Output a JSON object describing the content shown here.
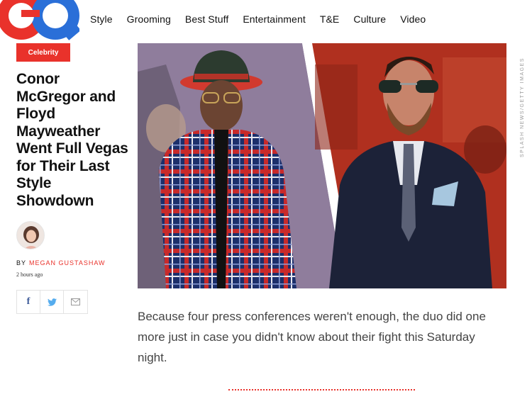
{
  "header": {
    "logo_text": "GQ",
    "nav": [
      "Style",
      "Grooming",
      "Best Stuff",
      "Entertainment",
      "T&E",
      "Culture",
      "Video"
    ]
  },
  "article": {
    "category": "Celebrity",
    "headline": "Conor McGregor and Floyd Mayweather Went Full Vegas for Their Last Style Showdown",
    "byline_prefix": "BY",
    "author": "MEGAN GUSTASHAW",
    "timestamp": "2 hours ago",
    "photo_credit": "SPLASH NEWS/GETTY IMAGES",
    "dek": "Because four press conferences weren't enough, the duo did one more just in case you didn't know about their fight this Saturday night."
  },
  "share": {
    "icons": [
      "facebook-icon",
      "twitter-icon",
      "email-icon"
    ],
    "facebook_glyph": "f"
  },
  "colors": {
    "accent": "#e9322b",
    "logo_blue": "#2a6fd8",
    "logo_red": "#e9322b"
  }
}
